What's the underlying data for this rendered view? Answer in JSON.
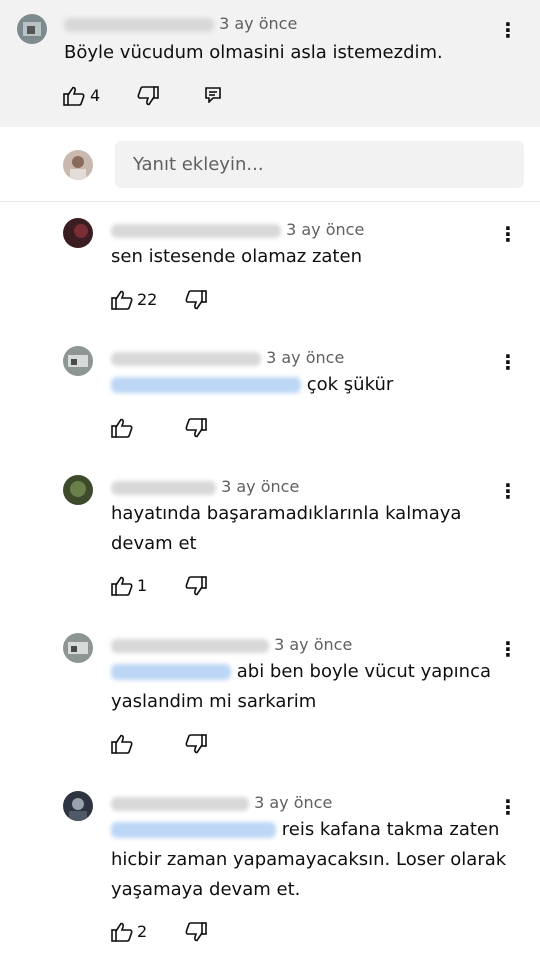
{
  "top_comment": {
    "time": "3 ay önce",
    "text": "Böyle vücudum olmasini asla istemezdim.",
    "likes": "4"
  },
  "reply_input": {
    "placeholder": "Yanıt ekleyin..."
  },
  "replies": [
    {
      "time": "3 ay önce",
      "text": "sen istesende olamaz zaten",
      "likes": "22"
    },
    {
      "time": "3 ay önce",
      "text": "çok şükür",
      "likes": ""
    },
    {
      "time": "3 ay önce",
      "text_lines": [
        "hayatında başaramadıklarınla kalmaya",
        "devam et"
      ],
      "likes": "1"
    },
    {
      "time": "3 ay önce",
      "text_lines": [
        "abi ben boyle vücut yapınca",
        "yaslandim mi sarkarim"
      ],
      "likes": ""
    },
    {
      "time": "3 ay önce",
      "text_lines": [
        "reis kafana takma zaten",
        "hicbir zaman yapamayacaksın. Loser olarak",
        "yaşamaya devam et."
      ],
      "likes": "2"
    }
  ],
  "icons": {
    "like": "thumbs-up-icon",
    "dislike": "thumbs-down-icon",
    "reply": "reply-icon",
    "more": "more-vert-icon"
  },
  "colors": {
    "panel_bg": "#f2f2f2",
    "text": "#0f0f0f",
    "meta": "#606060",
    "mention_blur": "#bcd6f5"
  }
}
